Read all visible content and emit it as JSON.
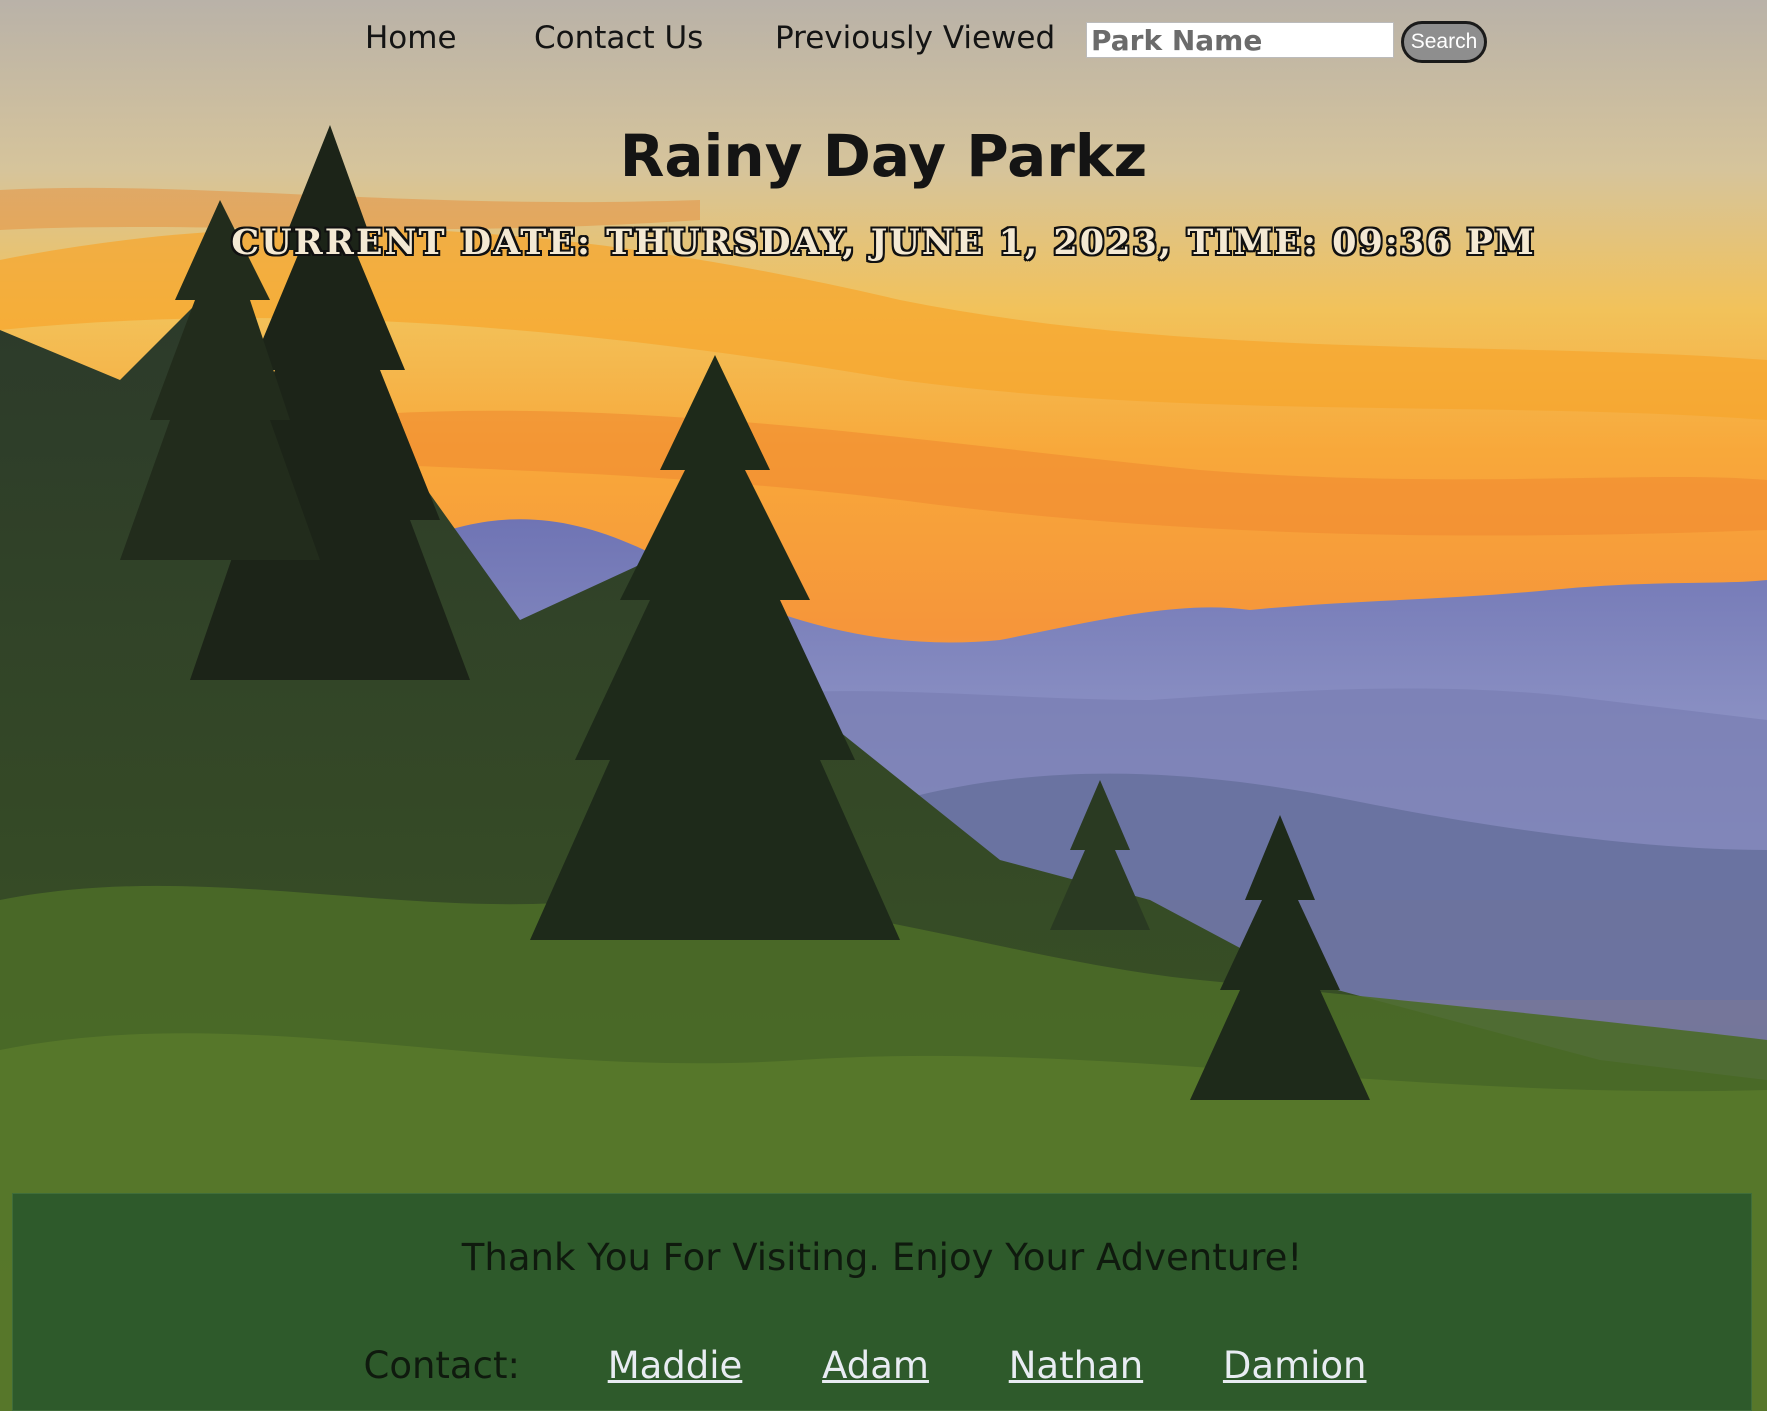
{
  "nav": {
    "home": "Home",
    "contact": "Contact Us",
    "previously_viewed": "Previously Viewed"
  },
  "search": {
    "placeholder": "Park Name",
    "button": "Search"
  },
  "header": {
    "title": "Rainy Day Parkz",
    "datetime": "Current Date: Thursday, June 1, 2023, Time: 09:36 PM"
  },
  "hero": {
    "icon": "mountain-sunset-forest-image"
  },
  "footer": {
    "message": "Thank You For Visiting. Enjoy Your Adventure!",
    "contact_label": "Contact:",
    "contacts": [
      "Maddie",
      "Adam",
      "Nathan",
      "Damion"
    ],
    "background": "#2e5a2b"
  },
  "colors": {
    "link": "#e8ecf2",
    "text": "#141414"
  }
}
